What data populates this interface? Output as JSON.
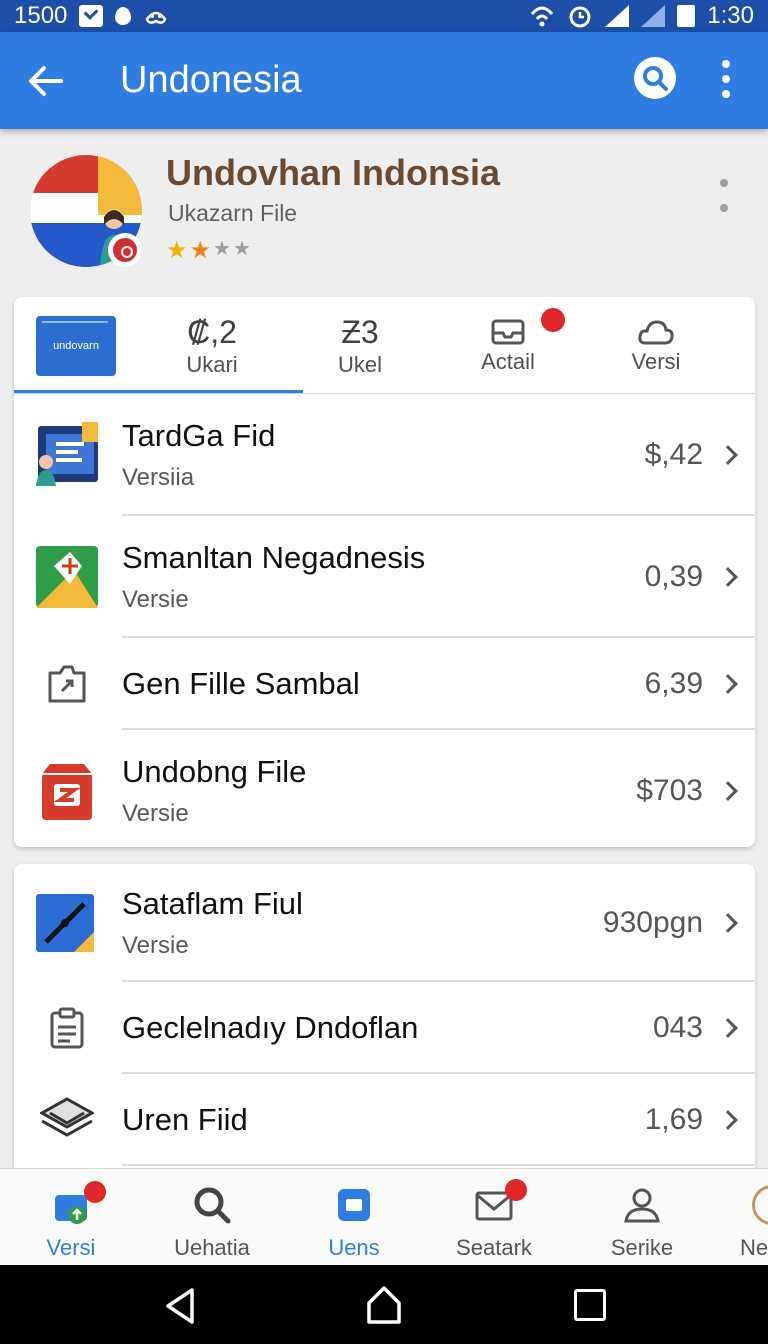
{
  "status_bar": {
    "time_left": "1500",
    "time_right": "1:30"
  },
  "app_bar": {
    "title": "Undonesia"
  },
  "profile": {
    "title": "Undovhan Indonsia",
    "subtitle": "Ukazarn File",
    "rating_filled": 2,
    "rating_total": 4
  },
  "tabs": [
    {
      "thumb_label": "undovarn"
    },
    {
      "value": "₡,2",
      "label": "Ukari"
    },
    {
      "value": "Ƶ3",
      "label": "Ukel"
    },
    {
      "label": "Actail"
    },
    {
      "label": "Versi"
    }
  ],
  "card1_rows": [
    {
      "title": "TardGa Fid",
      "subtitle": "Versiia",
      "value": "$,42",
      "icon": "document-person-icon"
    },
    {
      "title": "Smanltan  Negadnesis",
      "subtitle": "Versie",
      "value": "0,39",
      "icon": "map-pin-icon"
    },
    {
      "title": "Gen Fille Sambal",
      "subtitle": "",
      "value": "6,39",
      "icon": "folder-share-icon"
    },
    {
      "title": "Undobng File",
      "subtitle": "Versie",
      "value": "$703",
      "icon": "store-bag-icon"
    }
  ],
  "card2_rows": [
    {
      "title": "Sataflam Fiul",
      "subtitle": "Versie",
      "value": "930pgn",
      "icon": "compass-icon"
    },
    {
      "title": "Geclelnadıy Dndoflan",
      "subtitle": "",
      "value": "043",
      "icon": "clipboard-icon"
    },
    {
      "title": "Uren Fiid",
      "subtitle": "",
      "value": "1,69",
      "icon": "layers-icon"
    }
  ],
  "bottom_nav": [
    {
      "label": "Versi",
      "active": false
    },
    {
      "label": "Uehatia",
      "active": false
    },
    {
      "label": "Uens",
      "active": true
    },
    {
      "label": "Seatark",
      "active": false
    },
    {
      "label": "Serike",
      "active": false
    },
    {
      "label": "Ne",
      "active": false
    }
  ],
  "colors": {
    "primary": "#2f7de0",
    "status_bar": "#1d4ea8",
    "badge": "#e0262a"
  }
}
